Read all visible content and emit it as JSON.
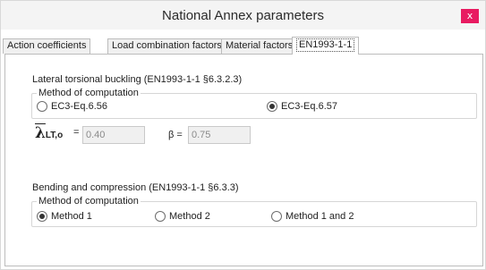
{
  "window": {
    "title": "National Annex parameters",
    "close_label": "x"
  },
  "tabs": [
    {
      "label": "Action coefficients"
    },
    {
      "label": "Load combination factors"
    },
    {
      "label": "Material factors"
    },
    {
      "label": "EN1993-1-1",
      "active": true
    }
  ],
  "ltb": {
    "heading": "Lateral torsional buckling (EN1993-1-1 §6.3.2.3)",
    "group_label": "Method of computation",
    "options": [
      {
        "label": "EC3-Eq.6.56",
        "selected": false
      },
      {
        "label": "EC3-Eq.6.57",
        "selected": true
      }
    ],
    "lambda_symbol": "λ",
    "lambda_subscript": "LT,o",
    "lambda_eq": "=",
    "lambda_value": "0.40",
    "beta_label": "β =",
    "beta_value": "0.75"
  },
  "bending": {
    "heading": "Bending and compression (EN1993-1-1 §6.3.3)",
    "group_label": "Method of computation",
    "options": [
      {
        "label": "Method 1",
        "selected": true
      },
      {
        "label": "Method 2",
        "selected": false
      },
      {
        "label": "Method 1 and 2",
        "selected": false
      }
    ]
  }
}
